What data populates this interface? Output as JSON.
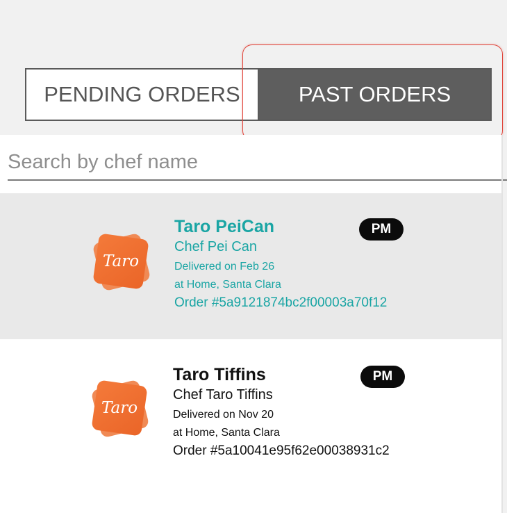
{
  "tabs": {
    "pending_label": "PENDING ORDERS",
    "past_label": "PAST ORDERS",
    "active": "past"
  },
  "search": {
    "placeholder": "Search by chef name",
    "value": ""
  },
  "orders": [
    {
      "restaurant": "Taro PeiCan",
      "chef": "Chef Pei Can",
      "delivered": "Delivered on Feb 26",
      "location": "at Home, Santa Clara",
      "order_id": "Order #5a9121874bc2f00003a70f12",
      "badge": "PM",
      "logo_text": "Taro",
      "selected": true
    },
    {
      "restaurant": "Taro Tiffins",
      "chef": "Chef Taro Tiffins",
      "delivered": "Delivered on Nov 20",
      "location": "at Home, Santa Clara",
      "order_id": "Order #5a10041e95f62e00038931c2",
      "badge": "PM",
      "logo_text": "Taro",
      "selected": false
    }
  ],
  "colors": {
    "accent_teal": "#1aa5a4",
    "tab_active_bg": "#5e5e5e",
    "highlight_border": "#e0443a",
    "logo_orange": "#f47a3a"
  }
}
